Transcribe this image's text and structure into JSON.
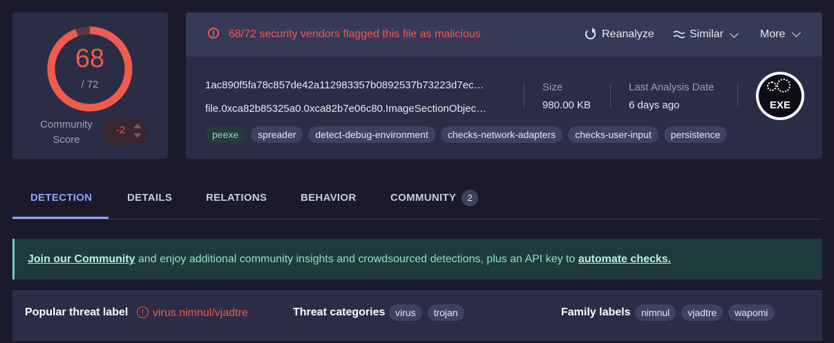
{
  "score": {
    "detections": "68",
    "total": "/ 72",
    "detections_fraction": 0.944
  },
  "community": {
    "label": "Community Score",
    "value": "-2"
  },
  "alert": {
    "text": "68/72 security vendors flagged this file as malicious"
  },
  "actions": {
    "reanalyze": "Reanalyze",
    "similar": "Similar",
    "more": "More"
  },
  "file": {
    "hash": "1ac890f5fa78c857de42a112983357b0892537b73223d7ec…",
    "name": "file.0xca82b85325a0.0xca82b7e06c80.ImageSectionObjec…",
    "size_label": "Size",
    "size_value": "980.00 KB",
    "date_label": "Last Analysis Date",
    "date_value": "6 days ago",
    "type_badge": "EXE"
  },
  "tags": [
    "peexe",
    "spreader",
    "detect-debug-environment",
    "checks-network-adapters",
    "checks-user-input",
    "persistence"
  ],
  "tabs": [
    {
      "label": "DETECTION"
    },
    {
      "label": "DETAILS"
    },
    {
      "label": "RELATIONS"
    },
    {
      "label": "BEHAVIOR"
    },
    {
      "label": "COMMUNITY",
      "badge": "2"
    }
  ],
  "banner": {
    "link1": "Join our Community",
    "middle": " and enjoy additional community insights and crowdsourced detections, plus an API key to ",
    "link2": "automate checks."
  },
  "threat": {
    "popular_label": "Popular threat label",
    "popular_value": "virus.nimnul/vjadtre",
    "categories_label": "Threat categories",
    "categories": [
      "virus",
      "trojan"
    ],
    "family_label": "Family labels",
    "families": [
      "nimnul",
      "vjadtre",
      "wapomi"
    ]
  },
  "colors": {
    "danger": "#ef5b4d",
    "accent": "#8ea6ff",
    "panel": "#2a2d45",
    "background": "#1b1a2b"
  }
}
